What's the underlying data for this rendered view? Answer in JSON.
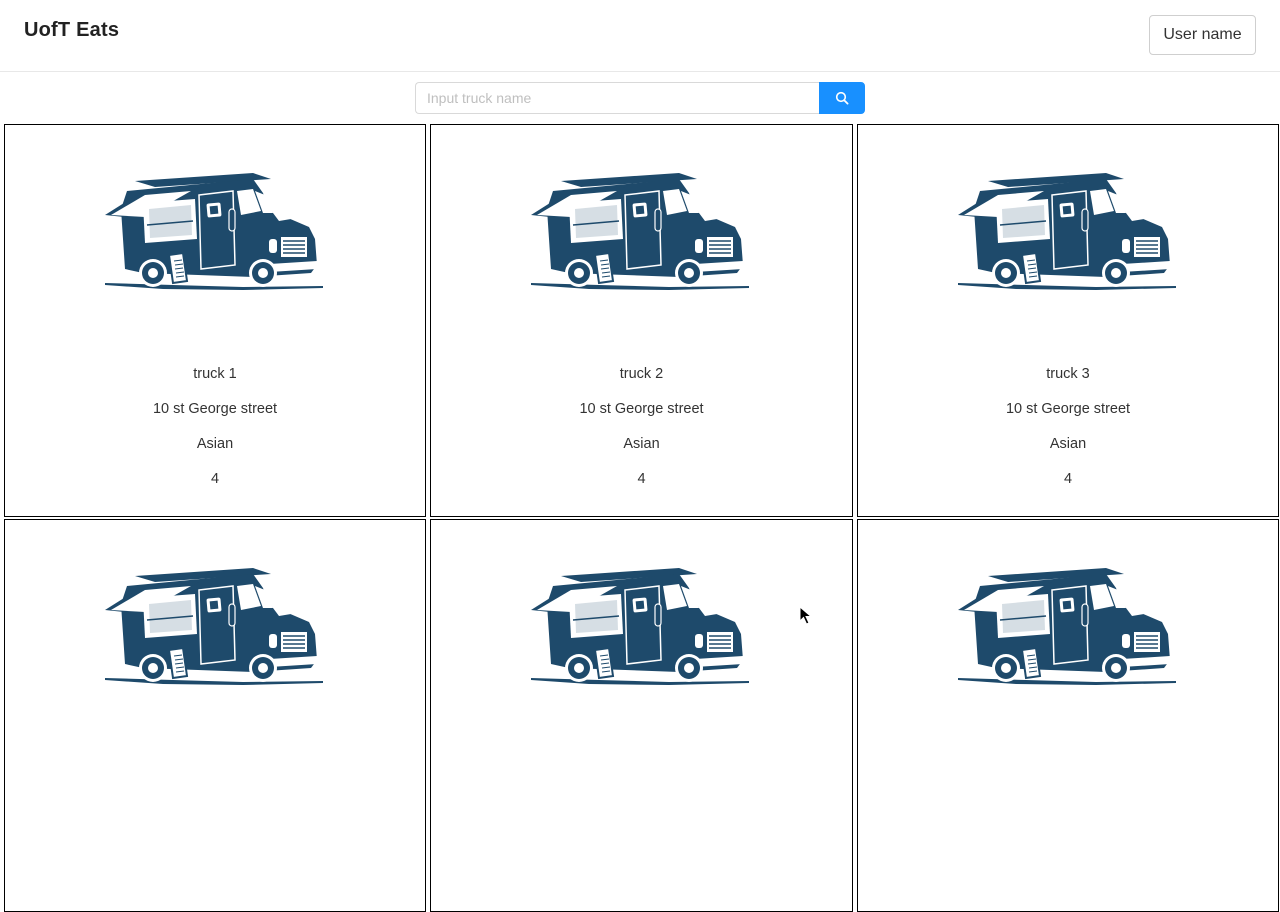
{
  "header": {
    "brand": "UofT Eats",
    "user_button": "User name"
  },
  "search": {
    "placeholder": "Input truck name",
    "button_icon": "search-icon"
  },
  "colors": {
    "primary": "#1890ff",
    "truck": "#1e4a6b"
  },
  "trucks": [
    {
      "name": "truck 1",
      "address": "10 st George street",
      "type": "Asian",
      "rating": "4",
      "image": "food-truck-image"
    },
    {
      "name": "truck 2",
      "address": "10 st George street",
      "type": "Asian",
      "rating": "4",
      "image": "food-truck-image"
    },
    {
      "name": "truck 3",
      "address": "10 st George street",
      "type": "Asian",
      "rating": "4",
      "image": "food-truck-image"
    },
    {
      "name": "",
      "address": "",
      "type": "",
      "rating": "",
      "image": "food-truck-image"
    },
    {
      "name": "",
      "address": "",
      "type": "",
      "rating": "",
      "image": "food-truck-image"
    },
    {
      "name": "",
      "address": "",
      "type": "",
      "rating": "",
      "image": "food-truck-image"
    }
  ]
}
